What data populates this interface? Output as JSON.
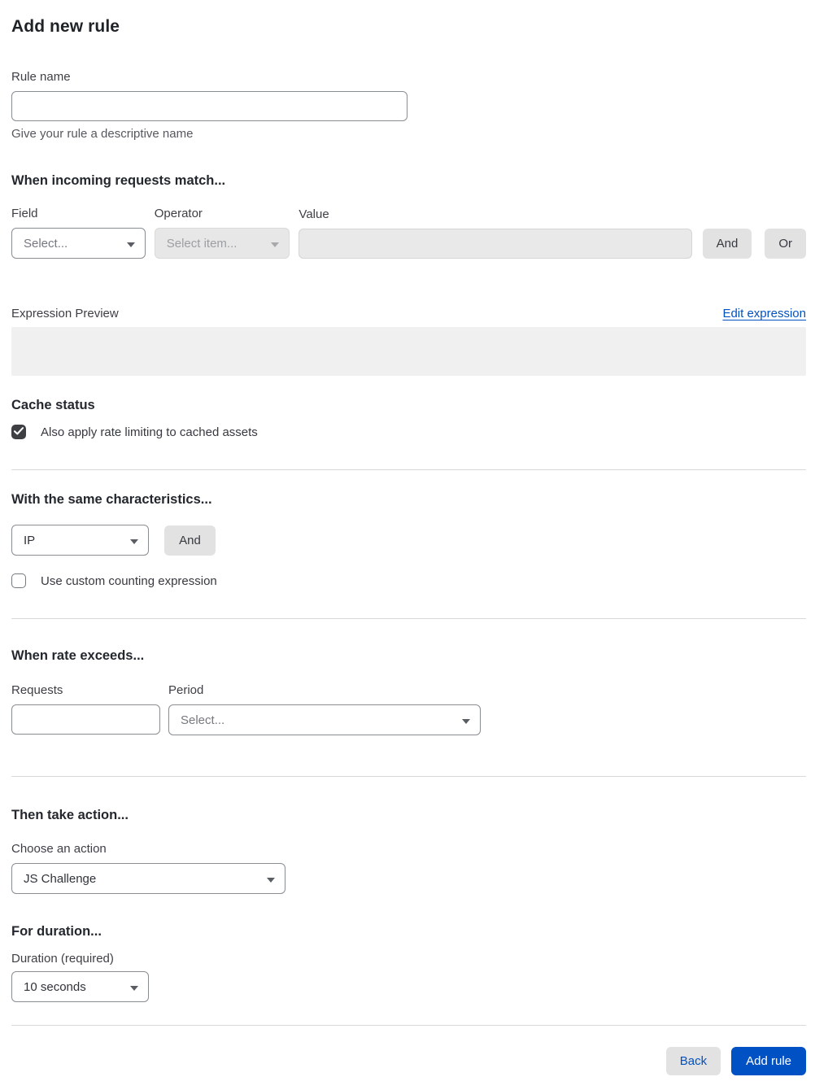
{
  "page": {
    "title": "Add new rule"
  },
  "rule_name": {
    "label": "Rule name",
    "value": "",
    "helper": "Give your rule a descriptive name"
  },
  "match": {
    "heading": "When incoming requests match...",
    "field": {
      "label": "Field",
      "selected": "Select..."
    },
    "operator": {
      "label": "Operator",
      "selected": "Select item..."
    },
    "value": {
      "label": "Value",
      "value": ""
    },
    "and_label": "And",
    "or_label": "Or"
  },
  "expression": {
    "preview_label": "Expression Preview",
    "edit_link_label": "Edit expression",
    "preview_value": ""
  },
  "cache_status": {
    "heading": "Cache status",
    "checkbox_label": "Also apply rate limiting to cached assets",
    "checked": true
  },
  "characteristics": {
    "heading": "With the same characteristics...",
    "selected": "IP",
    "and_label": "And",
    "checkbox_label": "Use custom counting expression",
    "checked": false
  },
  "rate": {
    "heading": "When rate exceeds...",
    "requests_label": "Requests",
    "requests_value": "",
    "period_label": "Period",
    "period_selected": "Select..."
  },
  "action": {
    "heading": "Then take action...",
    "label": "Choose an action",
    "selected": "JS Challenge"
  },
  "duration": {
    "heading": "For duration...",
    "label": "Duration (required)",
    "selected": "10 seconds"
  },
  "footer": {
    "back_label": "Back",
    "add_rule_label": "Add rule"
  },
  "colors": {
    "accent_blue": "#0051c3",
    "disabled_bg": "#e7e7e7",
    "divider": "#d9d9d9",
    "preview_bg": "#f0f0f0",
    "checkbox_checked": "#3d3f43",
    "button_gray": "#e2e2e2"
  },
  "icons": {
    "chevron_down": "chevron-down-icon",
    "checkmark": "checkmark-icon"
  }
}
